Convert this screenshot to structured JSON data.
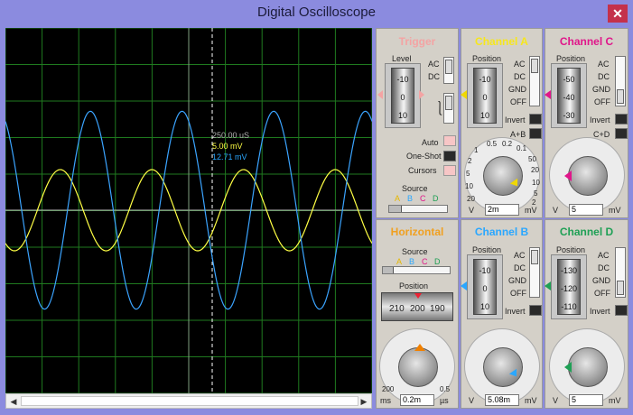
{
  "window": {
    "title": "Digital Oscilloscope",
    "close_glyph": "✕"
  },
  "readout": {
    "time": "250.00 uS",
    "chA": "5.00 mV",
    "chB": "12.71 mV"
  },
  "colors": {
    "chA": "#ffff44",
    "chB": "#2aa7ff",
    "chC": "#e0168a",
    "chD": "#1fa055",
    "trigger_title": "#f4a3a3",
    "horizontal_title": "#f0a020",
    "grid": "#1f7a1f"
  },
  "waves": {
    "chA": {
      "color": "#ffff44",
      "amp": 1.0,
      "period_div": 2.5
    },
    "chB": {
      "color": "#3ba4ff",
      "amp": 2.55,
      "period_div": 2.5
    }
  },
  "trigger": {
    "title": "Trigger",
    "level_label": "Level",
    "ticks": [
      "-10",
      "0",
      "10"
    ],
    "ac": "AC",
    "dc": "DC",
    "auto": "Auto",
    "oneshot": "One-Shot",
    "cursors": "Cursors",
    "source_label": "Source",
    "sources": [
      "A",
      "B",
      "C",
      "D"
    ]
  },
  "channelA": {
    "title": "Channel A",
    "position_label": "Position",
    "ticks": [
      "-10",
      "0",
      "10"
    ],
    "ac": "AC",
    "dc": "DC",
    "gnd": "GND",
    "off": "OFF",
    "invert": "Invert",
    "extra": "A+B",
    "dial_labels": [
      "0.5",
      "0.2",
      "0.1",
      "1",
      "2",
      "5",
      "10",
      "20",
      "50",
      "20",
      "10",
      "5",
      "2"
    ],
    "value": "2m",
    "unit_left": "V",
    "unit_right": "mV"
  },
  "channelC": {
    "title": "Channel C",
    "position_label": "Position",
    "ticks": [
      "-50",
      "-40",
      "-30"
    ],
    "ac": "AC",
    "dc": "DC",
    "gnd": "GND",
    "off": "OFF",
    "invert": "Invert",
    "extra": "C+D",
    "value": "5",
    "unit_left": "V",
    "unit_right": "mV"
  },
  "horizontal": {
    "title": "Horizontal",
    "source_label": "Source",
    "sources": [
      "A",
      "B",
      "C",
      "D"
    ],
    "position_label": "Position",
    "pos_values": [
      "210",
      "200",
      "190"
    ],
    "value": "0.2m",
    "unit_left": "ms",
    "unit_right": "µs",
    "dial_left": "200",
    "dial_right": "0.5"
  },
  "channelB": {
    "title": "Channel B",
    "position_label": "Position",
    "ticks": [
      "-10",
      "0",
      "10"
    ],
    "ac": "AC",
    "dc": "DC",
    "gnd": "GND",
    "off": "OFF",
    "invert": "Invert",
    "value": "5.08m",
    "unit_left": "V",
    "unit_right": "mV"
  },
  "channelD": {
    "title": "Channel D",
    "position_label": "Position",
    "ticks": [
      "-130",
      "-120",
      "-110"
    ],
    "ac": "AC",
    "dc": "DC",
    "gnd": "GND",
    "off": "OFF",
    "invert": "Invert",
    "value": "5",
    "unit_left": "V",
    "unit_right": "mV"
  }
}
